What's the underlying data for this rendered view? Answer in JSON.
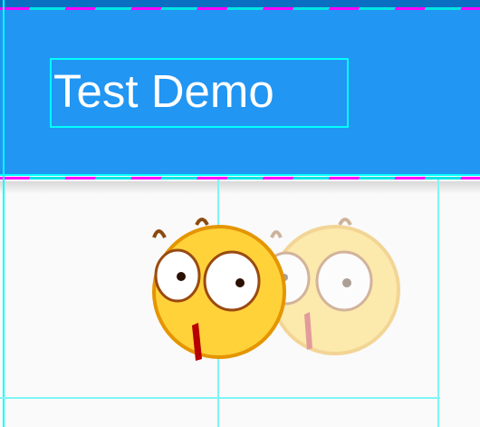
{
  "app_bar": {
    "title": "Test Demo"
  },
  "colors": {
    "primary": "#2196F3",
    "status_bar": "#0A6FC2",
    "background": "#FAFAFA",
    "debug_bounds": "#00FFFF"
  },
  "content": {
    "icons": [
      "surprised-emoji-icon",
      "surprised-emoji-faded-icon"
    ]
  }
}
